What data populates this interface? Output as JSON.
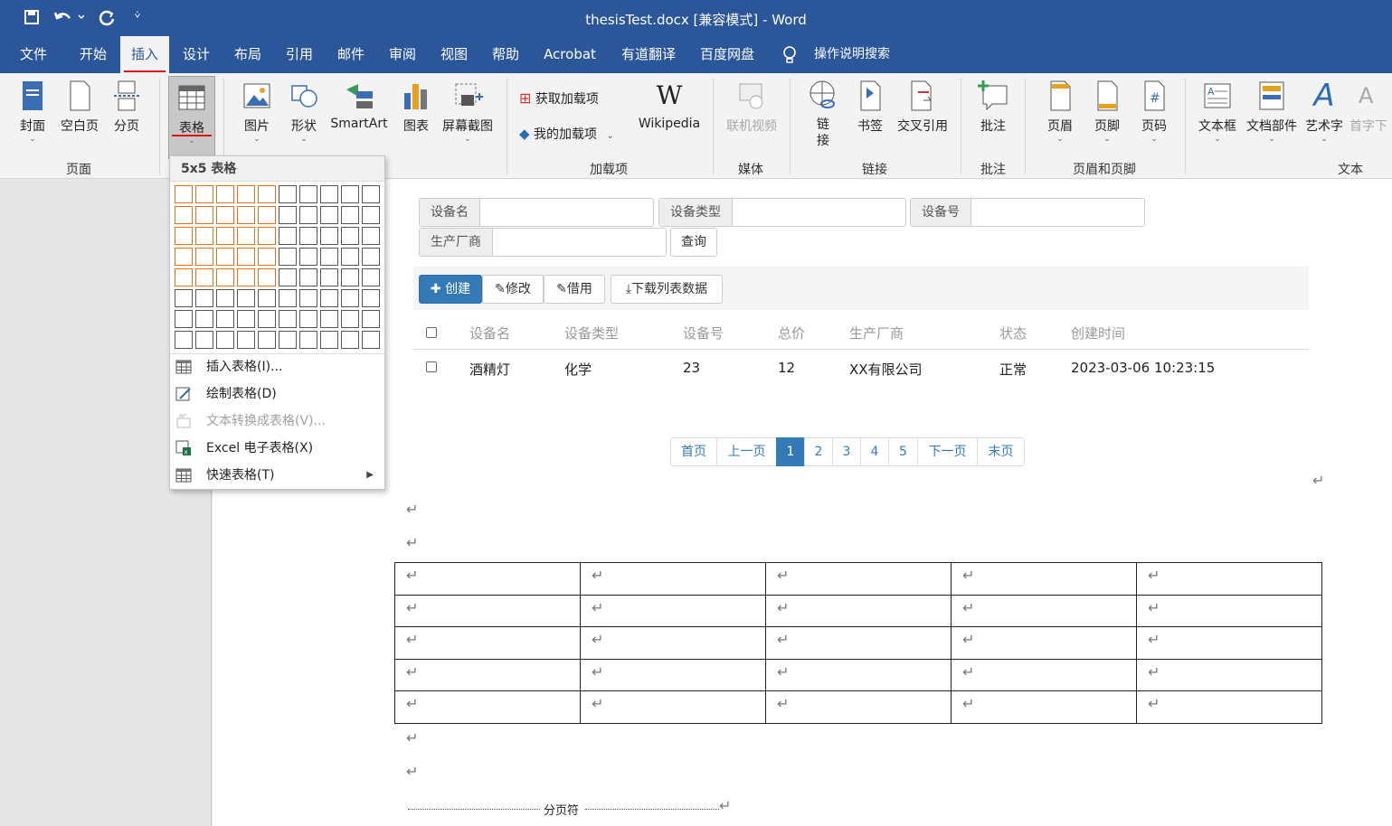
{
  "title_bar": {
    "title": "thesisTest.docx [兼容模式]  -  Word",
    "save_icon": "save-icon",
    "undo_icon": "undo-icon",
    "redo_icon": "redo-icon"
  },
  "menu_tabs": [
    "文件",
    "开始",
    "插入",
    "设计",
    "布局",
    "引用",
    "邮件",
    "审阅",
    "视图",
    "帮助",
    "Acrobat",
    "有道翻译",
    "百度网盘"
  ],
  "active_tab": "插入",
  "tell_me": "操作说明搜索",
  "ribbon": {
    "pages_group": {
      "label": "页面",
      "buttons": [
        "封面",
        "空白页",
        "分页"
      ]
    },
    "table_button": "表格",
    "illustrations": [
      "图片",
      "形状",
      "SmartArt",
      "图表",
      "屏幕截图"
    ],
    "addins_group": {
      "label": "加载项",
      "get_addins": "获取加载项",
      "my_addins": "我的加载项",
      "wikipedia": "Wikipedia"
    },
    "media_group": {
      "label": "媒体",
      "online_video": "联机视频"
    },
    "links_group": {
      "label": "链接",
      "buttons": [
        "链\n接",
        "书签",
        "交叉引用"
      ]
    },
    "comments_group": {
      "label": "批注",
      "comment": "批注"
    },
    "header_footer_group": {
      "label": "页眉和页脚",
      "buttons": [
        "页眉",
        "页脚",
        "页码"
      ]
    },
    "text_group": {
      "label": "文本",
      "buttons": [
        "文本框",
        "文档部件",
        "艺术字",
        "首字下"
      ]
    }
  },
  "table_menu": {
    "grid_label": "5x5 表格",
    "grid_rows": 8,
    "grid_cols": 10,
    "selected_rows": 5,
    "selected_cols": 5,
    "items": [
      {
        "label": "插入表格(I)...",
        "enabled": true
      },
      {
        "label": "绘制表格(D)",
        "enabled": true
      },
      {
        "label": "文本转换成表格(V)...",
        "enabled": false
      },
      {
        "label": "Excel 电子表格(X)",
        "enabled": true
      },
      {
        "label": "快速表格(T)",
        "enabled": true,
        "submenu": true
      }
    ]
  },
  "doc": {
    "search": {
      "device_name": "设备名",
      "device_type": "设备类型",
      "device_no": "设备号",
      "manufacturer": "生产厂商",
      "query": "查询"
    },
    "toolbar": {
      "create": "创建",
      "edit": "修改",
      "borrow": "借用",
      "download": "下载列表数据"
    },
    "columns": [
      "设备名",
      "设备类型",
      "设备号",
      "总价",
      "生产厂商",
      "状态",
      "创建时间"
    ],
    "rows": [
      [
        "酒精灯",
        "化学",
        "23",
        "12",
        "XX有限公司",
        "正常",
        "2023-03-06 10:23:15"
      ]
    ],
    "pagination": [
      "首页",
      "上一页",
      "1",
      "2",
      "3",
      "4",
      "5",
      "下一页",
      "末页"
    ],
    "current_page": "1",
    "page_break": "分页符",
    "return_mark": "↵"
  }
}
